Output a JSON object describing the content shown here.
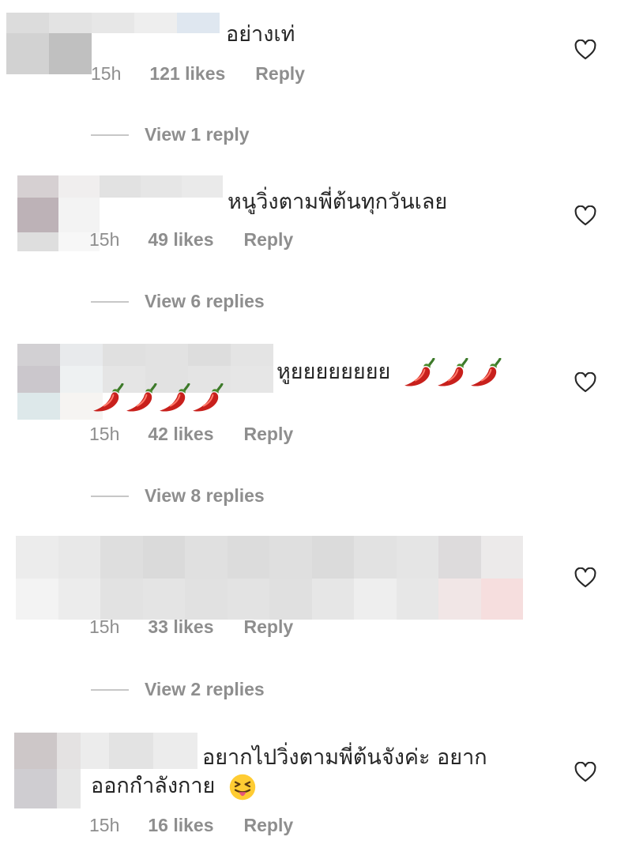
{
  "comments": [
    {
      "text": "อย่างเท่",
      "age": "15h",
      "likes": "121 likes",
      "reply": "Reply",
      "view_replies": "View 1 reply"
    },
    {
      "text": "หนูวิ่งตามพี่ต้นทุกวันเลย",
      "age": "15h",
      "likes": "49 likes",
      "reply": "Reply",
      "view_replies": "View 6 replies"
    },
    {
      "text": "หูยยยยยยยย",
      "age": "15h",
      "likes": "42 likes",
      "reply": "Reply",
      "view_replies": "View 8 replies",
      "emojis": [
        "chili-pepper-emoji",
        "chili-pepper-emoji",
        "chili-pepper-emoji",
        "chili-pepper-emoji",
        "chili-pepper-emoji",
        "chili-pepper-emoji",
        "chili-pepper-emoji"
      ]
    },
    {
      "text": "",
      "age": "15h",
      "likes": "33 likes",
      "reply": "Reply",
      "view_replies": "View 2 replies"
    },
    {
      "text_line1": "อยากไปวิ่งตามพี่ต้นจังค่ะ อยาก",
      "text_line2": "ออกกำลังกาย",
      "age": "15h",
      "likes": "16 likes",
      "reply": "Reply",
      "emojis": [
        "squinting-tongue-emoji"
      ]
    }
  ],
  "icons": {
    "like": "heart-outline-icon"
  },
  "colors": {
    "text": "#262626",
    "meta": "#8e8e8e",
    "chili": "#c8201c"
  }
}
